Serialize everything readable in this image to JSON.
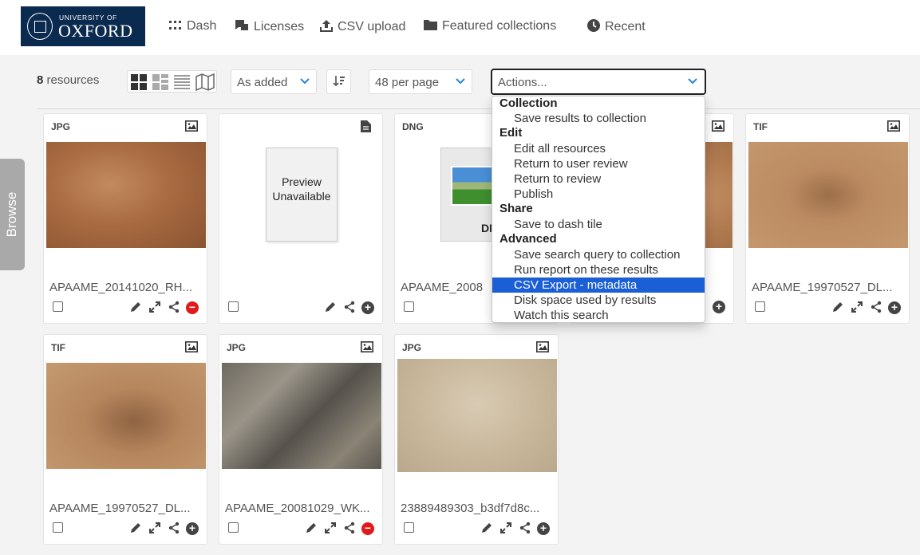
{
  "header": {
    "logo_small": "UNIVERSITY OF",
    "logo_big": "OXFORD",
    "nav": [
      {
        "label": "Dash",
        "icon": "grid-dots-icon"
      },
      {
        "label": "Licenses",
        "icon": "license-icon"
      },
      {
        "label": "CSV upload",
        "icon": "upload-icon"
      },
      {
        "label": "Featured collections",
        "icon": "folder-icon"
      },
      {
        "label": "Recent",
        "icon": "clock-icon"
      }
    ]
  },
  "toolbar": {
    "count": "8",
    "count_suffix": " resources",
    "sort_label": "As added",
    "per_page": "48 per page",
    "actions_placeholder": "Actions..."
  },
  "browse_label": "Browse",
  "actions_menu": {
    "groups": [
      {
        "label": "Collection",
        "items": [
          "Save results to collection"
        ]
      },
      {
        "label": "Edit",
        "items": [
          "Edit all resources",
          "Return to user review",
          "Return to review",
          "Publish"
        ]
      },
      {
        "label": "Share",
        "items": [
          "Save to dash tile"
        ]
      },
      {
        "label": "Advanced",
        "items": [
          "Save search query to collection",
          "Run report on these results",
          "CSV Export - metadata",
          "Disk space used by results",
          "Watch this search"
        ]
      }
    ],
    "highlighted": "CSV Export - metadata"
  },
  "resources": [
    {
      "ext": "JPG",
      "title": "APAAME_20141020_RH...",
      "type_icon": "image-icon",
      "remove": true
    },
    {
      "ext": "",
      "title": "",
      "type_icon": "document-icon",
      "preview": "Preview Unavailable",
      "remove": false
    },
    {
      "ext": "DNG",
      "title": "APAAME_2008",
      "type_icon": "image-icon",
      "dng_label": "DN",
      "remove": false
    },
    {
      "ext": "",
      "title": "",
      "type_icon": "image-icon",
      "remove": false
    },
    {
      "ext": "TIF",
      "title": "APAAME_19970527_DL...",
      "type_icon": "image-icon",
      "remove": false
    },
    {
      "ext": "TIF",
      "title": "APAAME_19970527_DL...",
      "type_icon": "image-icon",
      "remove": false
    },
    {
      "ext": "JPG",
      "title": "APAAME_20081029_WK...",
      "type_icon": "image-icon",
      "remove": true
    },
    {
      "ext": "JPG",
      "title": "23889489303_b3df7d8c...",
      "type_icon": "image-icon",
      "remove": false
    }
  ],
  "colors": {
    "brand_navy": "#0b2a4f",
    "highlight": "#1a5fd6",
    "remove_red": "#e0191b",
    "accent_blue": "#2a83d4"
  }
}
